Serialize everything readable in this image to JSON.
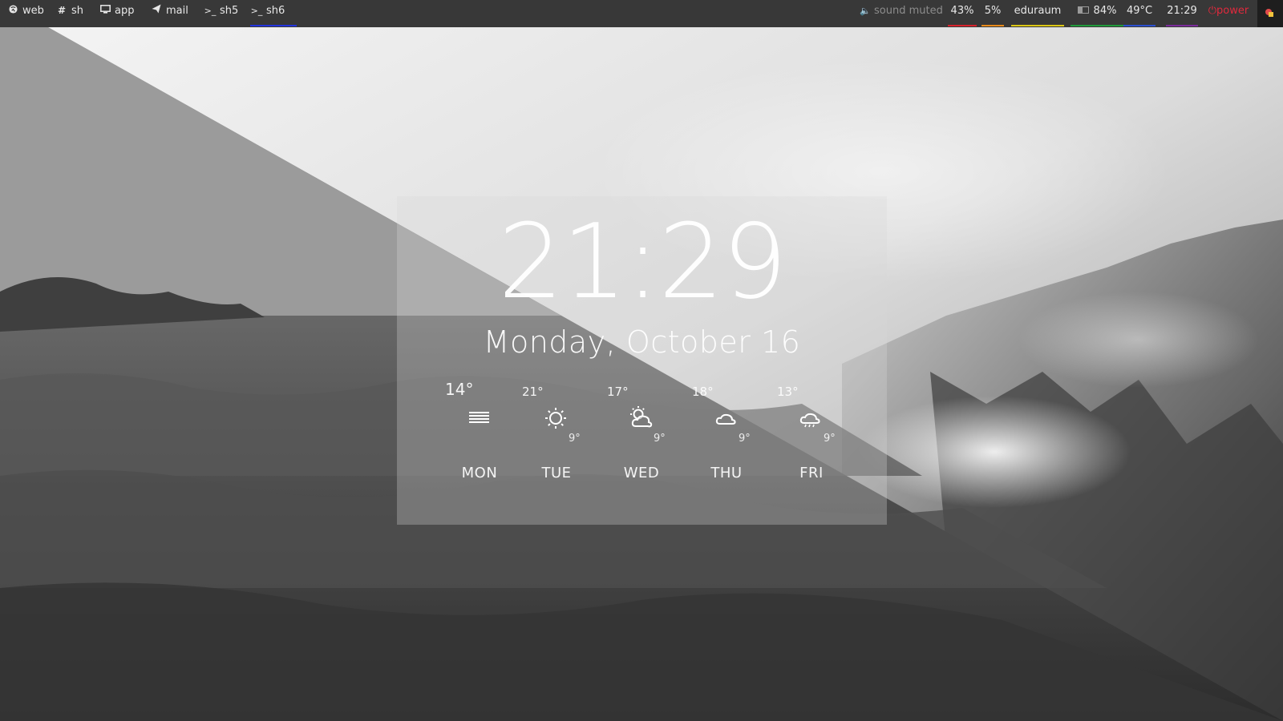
{
  "topbar": {
    "workspaces": [
      {
        "icon": "globe-icon",
        "label": "web",
        "active": false
      },
      {
        "icon": "hash-icon",
        "label": "sh",
        "active": false
      },
      {
        "icon": "monitor-icon",
        "label": "app",
        "active": false
      },
      {
        "icon": "paper-plane-icon",
        "label": "mail",
        "active": false
      },
      {
        "icon": "terminal-icon",
        "label": "sh5",
        "active": false
      },
      {
        "icon": "terminal-icon",
        "label": "sh6",
        "active": true
      }
    ],
    "active_color": "#2233dd",
    "status": {
      "sound": "sound muted",
      "cpu": "43%",
      "mem": "5%",
      "network": "eduraum",
      "battery": "84%",
      "temperature": "49°C",
      "time": "21:29",
      "power": "power"
    },
    "underline_colors": {
      "cpu": "#d8212b",
      "mem": "#e88a1a",
      "network": "#dcc614",
      "battery": "#1f9a3a",
      "temperature": "#2a4fd0",
      "time": "#7a2a9a"
    }
  },
  "lockscreen": {
    "time": "21:29",
    "date": "Monday, October 16",
    "forecast": [
      {
        "day": "MON",
        "high": "14°",
        "low": "",
        "icon": "fog-icon"
      },
      {
        "day": "TUE",
        "high": "21°",
        "low": "9°",
        "icon": "sun-icon"
      },
      {
        "day": "WED",
        "high": "17°",
        "low": "9°",
        "icon": "partly-cloudy-icon"
      },
      {
        "day": "THU",
        "high": "18°",
        "low": "9°",
        "icon": "cloud-icon"
      },
      {
        "day": "FRI",
        "high": "13°",
        "low": "9°",
        "icon": "rain-cloud-icon"
      }
    ]
  }
}
